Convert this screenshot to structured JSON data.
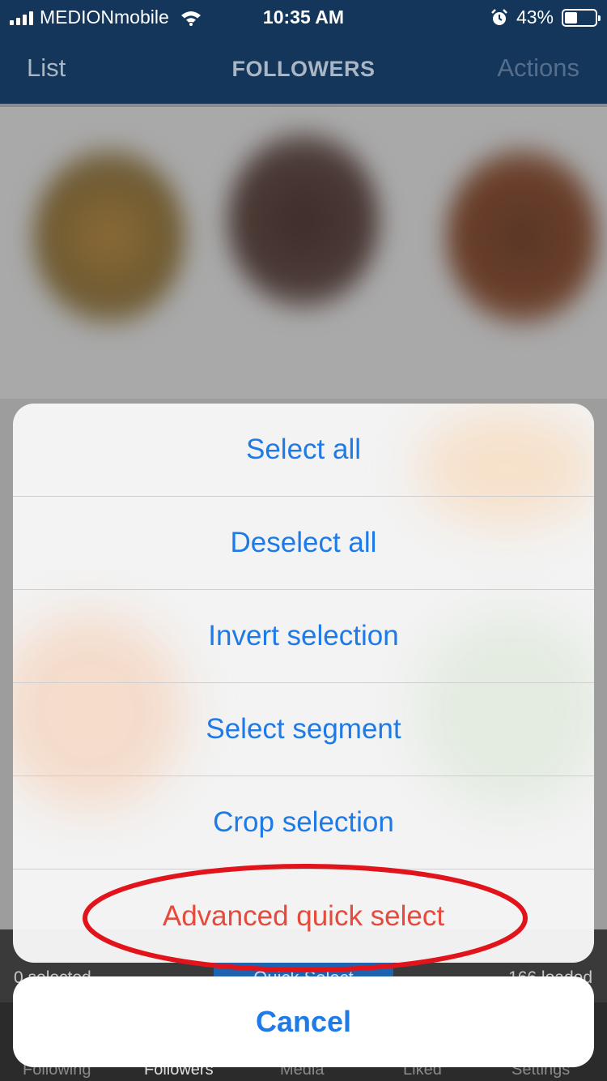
{
  "status_bar": {
    "carrier": "MEDIONmobile",
    "time": "10:35 AM",
    "battery": "43%",
    "battery_level": 0.43
  },
  "nav": {
    "left_label": "List",
    "title": "FOLLOWERS",
    "right_label": "Actions"
  },
  "bottom_bar": {
    "selected": "0 selected",
    "quick_select": "Quick Select",
    "loaded": "166 loaded"
  },
  "tabs": [
    "Following",
    "Followers",
    "Media",
    "Liked",
    "Settings"
  ],
  "action_sheet": {
    "options": [
      "Select all",
      "Deselect all",
      "Invert selection",
      "Select segment",
      "Crop selection",
      "Advanced quick select"
    ],
    "cancel": "Cancel"
  },
  "colors": {
    "accent": "#1e7ae6",
    "destructive": "#e64a3c",
    "nav_background": "#13365a",
    "highlight_ring": "#e2141b"
  }
}
